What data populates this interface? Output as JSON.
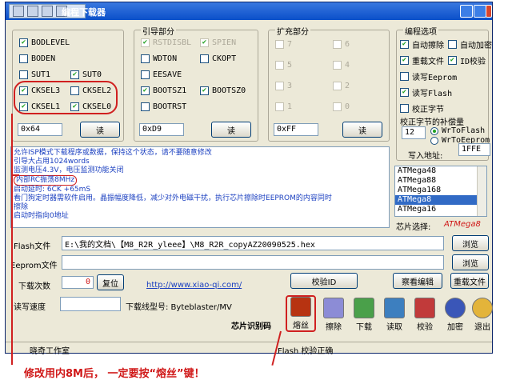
{
  "window": {
    "title": "编程下载器"
  },
  "fuse": {
    "items": [
      {
        "label": "BODLEVEL",
        "checked": true
      },
      {
        "label": "BODEN",
        "checked": false
      },
      {
        "label": "SUT1",
        "checked": false
      },
      {
        "label": "SUT0",
        "checked": true
      },
      {
        "label": "CKSEL3",
        "checked": true
      },
      {
        "label": "CKSEL2",
        "checked": false
      },
      {
        "label": "CKSEL1",
        "checked": true
      },
      {
        "label": "CKSEL0",
        "checked": true
      }
    ],
    "value": "0x64",
    "read_label": "读"
  },
  "boot": {
    "title": "引导部分",
    "items": [
      {
        "label": "RSTDISBL",
        "checked": true,
        "disabled": true
      },
      {
        "label": "SPIEN",
        "checked": true,
        "disabled": true
      },
      {
        "label": "WDTON",
        "checked": false
      },
      {
        "label": "CKOPT",
        "checked": false
      },
      {
        "label": "EESAVE",
        "checked": false
      },
      {
        "label": "BOOTSZ1",
        "checked": true
      },
      {
        "label": "BOOTSZ0",
        "checked": true
      },
      {
        "label": "BOOTRST",
        "checked": false
      }
    ],
    "value": "0xD9",
    "read_label": "读"
  },
  "ext": {
    "title": "扩充部分",
    "items": [
      "7",
      "6",
      "5",
      "4",
      "3",
      "2",
      "1",
      "0"
    ],
    "value": "0xFF",
    "read_label": "读"
  },
  "options": {
    "title": "编程选项",
    "items": [
      {
        "label": "自动擦除",
        "checked": true
      },
      {
        "label": "自动加密",
        "checked": false
      },
      {
        "label": "重载文件",
        "checked": true
      },
      {
        "label": "ID校验",
        "checked": true
      },
      {
        "label": "读写Eeprom",
        "checked": false
      },
      {
        "label": "读写Flash",
        "checked": true
      },
      {
        "label": "校正字节",
        "checked": false
      }
    ],
    "cal_label": "校正字节的补偿量",
    "cal_value": "12",
    "radio_flash": "WrToFlash",
    "radio_eeprom": "WrToEeprom",
    "addr_label": "写入地址:",
    "addr_value": "1FFE"
  },
  "log": [
    "允许ISP模式下载程序或数据，保持这个状态，请不要随意修改",
    "引导大占用1024words",
    "监测电压4.3V，电压监测功能关闭",
    "内部RC振荡8MHz",
    "启动延时: 6CK +65mS",
    "看门狗定时器需软件启用。晶振幅度降低，减少对外电磁干扰，执行芯片擦除时EEPROM的内容同时",
    "擦除",
    "启动时指向0地址"
  ],
  "chips": {
    "list": [
      "ATMega48",
      "ATMega88",
      "ATMega168",
      "ATMega8",
      "ATMega16"
    ],
    "selected_index": 3,
    "select_label": "芯片选择:",
    "selected": "ATMega8"
  },
  "files": {
    "flash_label": "Flash文件",
    "flash_path": "E:\\我的文档\\【M8_R2R_yleee】\\M8_R2R_copyAZ20090525.hex",
    "eeprom_label": "Eeprom文件",
    "eeprom_path": "",
    "browse": "浏览"
  },
  "misc": {
    "count_label": "下载次数",
    "count_value": "0",
    "reset_label": "复位",
    "url": "http://www.xiao-qi.com/",
    "check_id": "校验ID",
    "view_edit": "察看编辑",
    "reload": "重载文件",
    "speed_label": "读写速度",
    "cable_label": "下载线型号: Byteblaster/MV",
    "chip_id_label": "芯片识别码"
  },
  "tools": [
    "熔丝",
    "擦除",
    "下载",
    "读取",
    "校验",
    "加密",
    "退出"
  ],
  "status": {
    "left": "晓奇工作室",
    "right": "Flash 校验正确"
  },
  "annotation": "修改用内8M后，   一定要按“熔丝”键！"
}
